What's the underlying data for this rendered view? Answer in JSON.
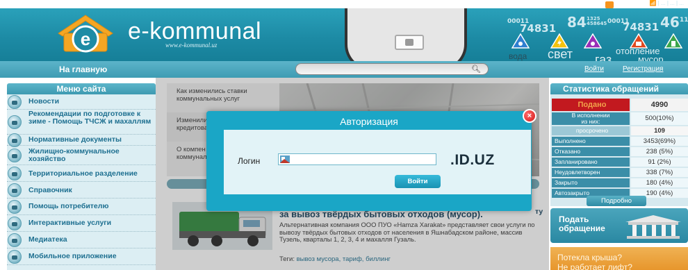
{
  "top_links": "📶 | ... | ... | ...",
  "header": {
    "brand": "e-kommunal",
    "brand_sub": "www.e-kommunal.uz",
    "counters": [
      "00011",
      "74831",
      "84",
      "1325 458645",
      "00011",
      "74831",
      "46",
      "11"
    ],
    "utility_labels": {
      "water": "вода",
      "electricity": "свет",
      "gas": "газ",
      "heating": "отопление",
      "garbage": "мусор"
    }
  },
  "nav": {
    "home": "На главную",
    "login": "Войти",
    "register": "Регистрация"
  },
  "menu": {
    "title": "Меню сайта",
    "items": [
      {
        "label": "Новости"
      },
      {
        "label": "Рекомендации по подготовке к зиме - Помощь ТЧСЖ и махаллям"
      },
      {
        "label": "Нормативные документы"
      },
      {
        "label": "Жилищно-коммунальное хозяйство"
      },
      {
        "label": "Территориальное разделение"
      },
      {
        "label": "Справочник"
      },
      {
        "label": "Помощь потребителю"
      },
      {
        "label": "Интерактивные услуги"
      },
      {
        "label": "Медиатека"
      },
      {
        "label": "Мобильное приложение"
      }
    ]
  },
  "news_cards": [
    {
      "text": "Как изменились ставки\nкоммунальных услуг"
    },
    {
      "text": "Изменили\nкредитова"
    },
    {
      "text": "О компен\nкоммунал"
    }
  ],
  "article": {
    "title": "за вывоз твёрдых бытовых отходов (мусор).",
    "title_tail": "ту",
    "body": "Альтернативная компания ООО ПУО «Hamza Xarakat» представляет свои услуги по вывозу твёрдых бытовых отходов от населения в Яшнабадском районе, массив Тузель, кварталы 1, 2, 3, 4 и махалля Гузаль.",
    "tags_label": "Теги:",
    "tags": "вывоз мусора,  тариф,  биллинг"
  },
  "stats": {
    "title": "Статистика обращений",
    "rows": [
      {
        "label": "Подано",
        "value": "4990"
      },
      {
        "label": "В исполнении\nиз них:",
        "value": "500(10%)"
      },
      {
        "label": "просрочено",
        "value": "109"
      },
      {
        "label": "Выполнено",
        "value": "3453(69%)"
      },
      {
        "label": "Отказано",
        "value": "238  (5%)"
      },
      {
        "label": "Запланировано",
        "value": "91  (2%)"
      },
      {
        "label": "Неудовлетворен",
        "value": "338  (7%)"
      },
      {
        "label": "Закрыто",
        "value": "180  (4%)"
      },
      {
        "label": "Автозакрыто",
        "value": "190  (4%)"
      }
    ],
    "more": "Подробно"
  },
  "submit_request": "Подать\nобращение",
  "roof_banner": "Потекла крыша?\nНе работает лифт?",
  "dialog": {
    "title": "Авторизация",
    "login_label": "Логин",
    "login_value": "",
    "suffix": ".ID.UZ",
    "login_button": "Войти",
    "close": "×"
  },
  "colors": {
    "header": "#1d8ba5",
    "dialog": "#1aa6c6",
    "submitted": "#c2191f",
    "menu_text": "#1d6f90"
  }
}
